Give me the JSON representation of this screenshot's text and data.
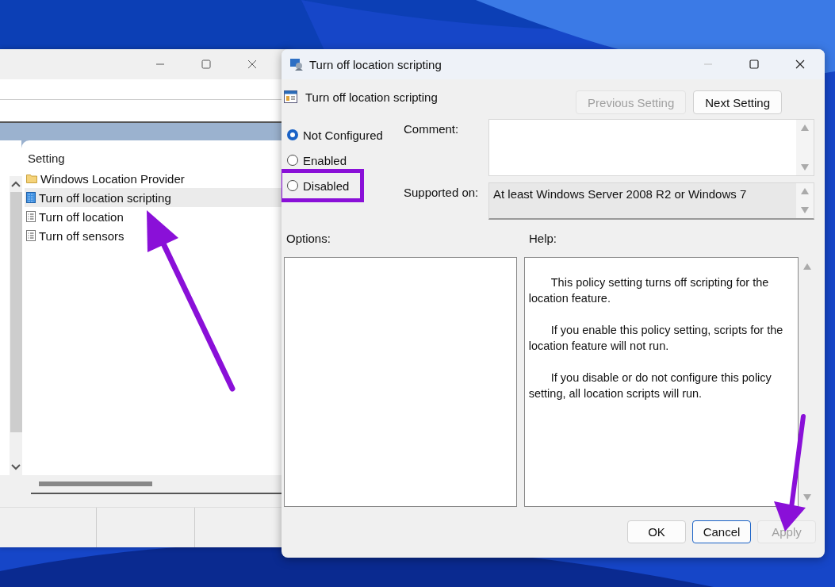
{
  "left_window": {
    "list": {
      "header": "Setting",
      "items": [
        {
          "kind": "folder",
          "label": "Windows Location Provider",
          "selected": false
        },
        {
          "kind": "policy",
          "label": "Turn off location scripting",
          "selected": true
        },
        {
          "kind": "policy",
          "label": "Turn off location",
          "selected": false
        },
        {
          "kind": "policy",
          "label": "Turn off sensors",
          "selected": false
        }
      ]
    }
  },
  "dialog": {
    "title": "Turn off location scripting",
    "setting_name": "Turn off location scripting",
    "nav_buttons": [
      {
        "label": "Previous Setting",
        "disabled": true
      },
      {
        "label": "Next Setting",
        "disabled": false
      }
    ],
    "states": [
      {
        "label": "Not Configured",
        "selected": true,
        "highlighted": false
      },
      {
        "label": "Enabled",
        "selected": false,
        "highlighted": false
      },
      {
        "label": "Disabled",
        "selected": false,
        "highlighted": true
      }
    ],
    "comment_label": "Comment:",
    "supported_label": "Supported on:",
    "supported_value": "At least Windows Server 2008 R2 or Windows 7",
    "options_label": "Options:",
    "help_label": "Help:",
    "help_paragraphs": [
      "This policy setting turns off scripting for the location feature.",
      "If you enable this policy setting, scripts for the location feature will not run.",
      "If you disable or do not configure this policy setting, all location scripts will run."
    ],
    "buttons": [
      {
        "label": "OK",
        "disabled": false,
        "focused": false
      },
      {
        "label": "Cancel",
        "disabled": false,
        "focused": true
      },
      {
        "label": "Apply",
        "disabled": true,
        "focused": false
      }
    ]
  }
}
